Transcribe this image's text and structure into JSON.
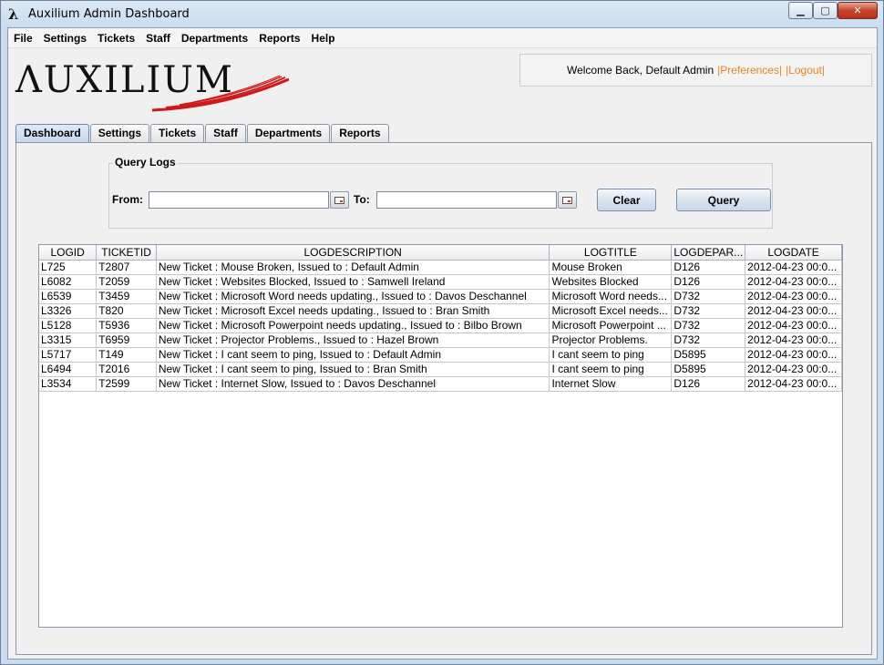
{
  "window": {
    "title": "Auxilium Admin Dashboard",
    "icon": "lambda-icon",
    "controls": {
      "minimize": "▁",
      "maximize": "▢",
      "close": "✕"
    }
  },
  "menubar": [
    "File",
    "Settings",
    "Tickets",
    "Staff",
    "Departments",
    "Reports",
    "Help"
  ],
  "logo": {
    "text": "ΛUXILIUM"
  },
  "welcome": {
    "text": "Welcome Back, Default Admin",
    "preferences": "|Preferences|",
    "logout": "|Logout|"
  },
  "tabs": [
    {
      "label": "Dashboard",
      "active": true
    },
    {
      "label": "Settings"
    },
    {
      "label": "Tickets"
    },
    {
      "label": "Staff"
    },
    {
      "label": "Departments"
    },
    {
      "label": "Reports"
    }
  ],
  "query": {
    "legend": "Query Logs",
    "from_label": "From:",
    "to_label": "To:",
    "from_value": "",
    "to_value": "",
    "clear_label": "Clear",
    "query_label": "Query"
  },
  "table": {
    "headers": [
      "LOGID",
      "TICKETID",
      "LOGDESCRIPTION",
      "LOGTITLE",
      "LOGDEPAR...",
      "LOGDATE"
    ],
    "rows": [
      [
        "L725",
        "T2807",
        "New Ticket : Mouse Broken, Issued to : Default Admin",
        "Mouse Broken",
        "D126",
        "2012-04-23 00:0..."
      ],
      [
        "L6082",
        "T2059",
        "New Ticket : Websites Blocked, Issued to : Samwell Ireland",
        "Websites Blocked",
        "D126",
        "2012-04-23 00:0..."
      ],
      [
        "L6539",
        "T3459",
        "New Ticket : Microsoft Word needs updating., Issued to : Davos Deschannel",
        "Microsoft Word needs...",
        "D732",
        "2012-04-23 00:0..."
      ],
      [
        "L3326",
        "T820",
        "New Ticket : Microsoft Excel needs updating., Issued to : Bran Smith",
        "Microsoft Excel needs...",
        "D732",
        "2012-04-23 00:0..."
      ],
      [
        "L5128",
        "T5936",
        "New Ticket : Microsoft Powerpoint needs updating., Issued to : Bilbo Brown",
        "Microsoft Powerpoint ...",
        "D732",
        "2012-04-23 00:0..."
      ],
      [
        "L3315",
        "T6959",
        "New Ticket : Projector Problems., Issued to : Hazel Brown",
        "Projector Problems.",
        "D732",
        "2012-04-23 00:0..."
      ],
      [
        "L5717",
        "T149",
        "New Ticket : I cant seem to ping, Issued to : Default Admin",
        "I cant seem to ping",
        "D5895",
        "2012-04-23 00:0..."
      ],
      [
        "L6494",
        "T2016",
        "New Ticket : I cant seem to ping, Issued to : Bran Smith",
        "I cant seem to ping",
        "D5895",
        "2012-04-23 00:0..."
      ],
      [
        "L3534",
        "T2599",
        "New Ticket : Internet Slow, Issued to : Davos Deschannel",
        "Internet Slow",
        "D126",
        "2012-04-23 00:0..."
      ]
    ]
  }
}
